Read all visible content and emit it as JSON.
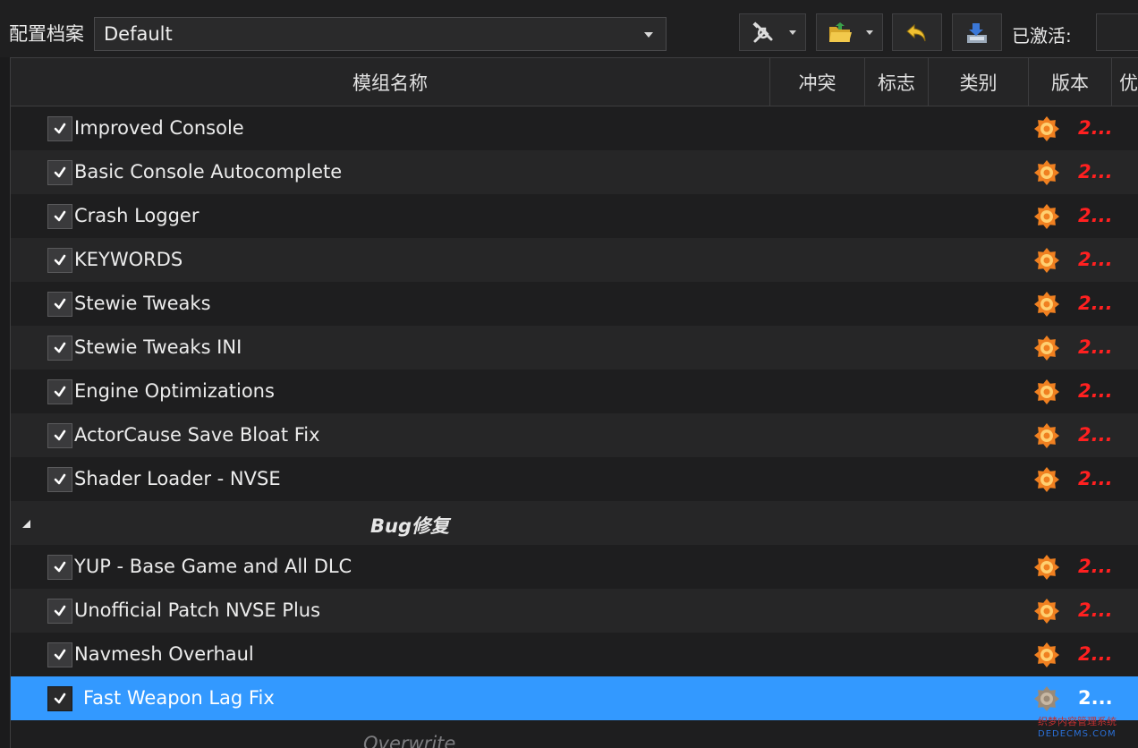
{
  "toolbar": {
    "profile_label": "配置档案",
    "profile_value": "Default",
    "active_label": "已激活:",
    "buttons": [
      {
        "name": "tools",
        "icon": "wrench-screwdriver-icon"
      },
      {
        "name": "open-folder",
        "icon": "folder-open-icon"
      },
      {
        "name": "undo",
        "icon": "undo-arrow-icon"
      },
      {
        "name": "export",
        "icon": "export-tray-icon"
      }
    ]
  },
  "columns": {
    "name": "模组名称",
    "conflicts": "冲突",
    "flags": "标志",
    "category": "类别",
    "version": "版本",
    "priority": "优先"
  },
  "rows_group1": [
    {
      "name": "Improved Console",
      "version": "2..."
    },
    {
      "name": "Basic Console Autocomplete",
      "version": "2..."
    },
    {
      "name": "Crash Logger",
      "version": "2..."
    },
    {
      "name": "KEYWORDS",
      "version": "2..."
    },
    {
      "name": "Stewie Tweaks",
      "version": "2..."
    },
    {
      "name": "Stewie Tweaks INI",
      "version": "2..."
    },
    {
      "name": "Engine Optimizations",
      "version": "2..."
    },
    {
      "name": "ActorCause Save Bloat Fix",
      "version": "2..."
    },
    {
      "name": "Shader Loader - NVSE",
      "version": "2..."
    }
  ],
  "separator": {
    "label": "Bug修复"
  },
  "rows_group2": [
    {
      "name": "YUP - Base Game and All DLC",
      "version": "2..."
    },
    {
      "name": "Unofficial Patch NVSE Plus",
      "version": "2..."
    },
    {
      "name": "Navmesh Overhaul",
      "version": "2..."
    },
    {
      "name": "Fast Weapon Lag Fix",
      "version": "2...",
      "selected": true
    }
  ],
  "overwrite": {
    "label": "Overwrite"
  },
  "colors": {
    "selection": "#3399ff",
    "version_warning": "#ff2020",
    "flag_icon": "#f08020"
  },
  "watermark": {
    "line1": "织梦内容管理系统",
    "line2": "DEDECMS.COM"
  }
}
